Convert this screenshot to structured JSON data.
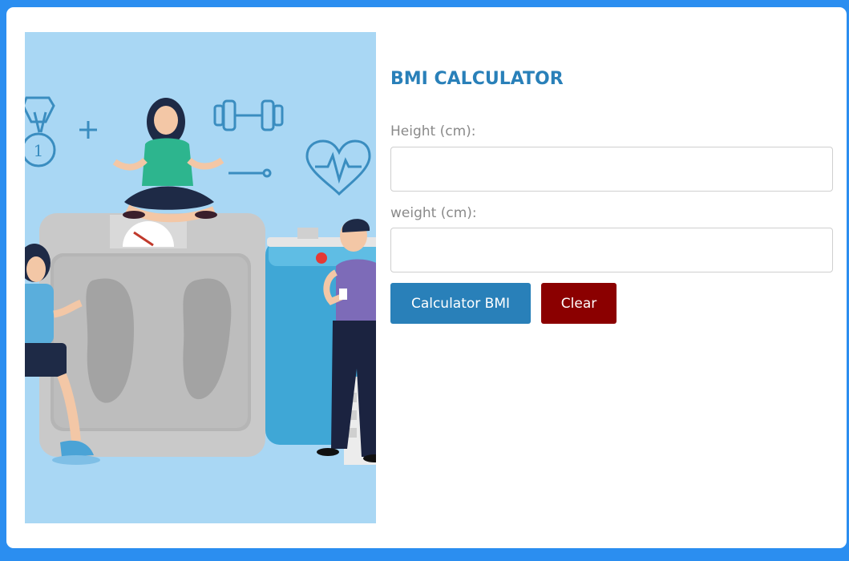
{
  "form": {
    "title": "BMI CALCULATOR",
    "height_label": "Height (cm):",
    "height_value": "",
    "weight_label": "weight (cm):",
    "weight_value": "",
    "calculate_label": "Calculator BMI",
    "clear_label": "Clear"
  },
  "colors": {
    "page_background": "#2b8ef0",
    "title": "#2980b9",
    "calculate_button": "#2980b9",
    "clear_button": "#8b0000",
    "illustration_background": "#a9d7f4"
  },
  "illustration": {
    "medal_number": "1"
  }
}
